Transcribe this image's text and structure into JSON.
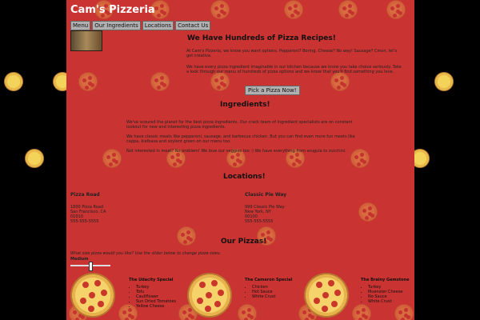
{
  "app": {
    "title": "Cam's Pizzeria"
  },
  "nav": [
    {
      "label": "Menu"
    },
    {
      "label": "Our Ingredients"
    },
    {
      "label": "Locations"
    },
    {
      "label": "Contact Us"
    }
  ],
  "hero": {
    "heading": "We Have Hundreds of Pizza Recipes!",
    "p1": "At Cam's Pizzeria, we know you want options. Pepperoni? Boring. Cheese? No way! Sausage? Cmon, let's get creative.",
    "p2": "We have every pizza ingredient imaginable in our kitchen because we know you take choice seriously. Take a look through our menu of hundreds of pizza options and we know that you'll find something you love.",
    "button": "Pick a Pizza Now!"
  },
  "ingredients": {
    "heading": "Ingredients!",
    "p1": "We've scoured the planet for the best pizza ingredients. Our crack team of ingredient specialists are on constant lookout for new and interesting pizza ingredients.",
    "p2": "We have classic meats like pepperoni, sausage, and barbecue chicken. But you can find even more fun meats like cappa, kielbasa and soylent green on our menu too.",
    "p3": "Not interested in meat? No problem! We love our veggies too :) We have everything from arugula to zucchini."
  },
  "locations": {
    "heading": "Locations!",
    "items": [
      {
        "name": "Pizza Road",
        "line1": "1800 Pizza Road",
        "line2": "San Francisco, CA",
        "line3": "01010",
        "line4": "555-555-5555"
      },
      {
        "name": "Classic Pie Way",
        "line1": "999 Classic Pie Way",
        "line2": "New York, NY",
        "line3": "00100",
        "line4": "555-555-5555"
      }
    ]
  },
  "pizzas": {
    "heading": "Our Pizzas!",
    "prompt": "What size pizza would you like? Use the slider below to change pizza sizes.",
    "size_label": "Medium",
    "items": [
      {
        "name": "The Udacity Special",
        "toppings": [
          "Turkey",
          "Tofu",
          "Cauliflower",
          "Sun Dried Tomatoes",
          "Yellow Cheese"
        ]
      },
      {
        "name": "The Cameron Special",
        "toppings": [
          "Chicken",
          "Hot Sauce",
          "White Crust"
        ]
      },
      {
        "name": "The Brainy Gemstone",
        "toppings": [
          "Turkey",
          "Muenster Cheese",
          "No Sauce",
          "White Crust"
        ]
      }
    ]
  },
  "colors": {
    "page_bg": "#c93332",
    "outer_bg": "#000000"
  }
}
